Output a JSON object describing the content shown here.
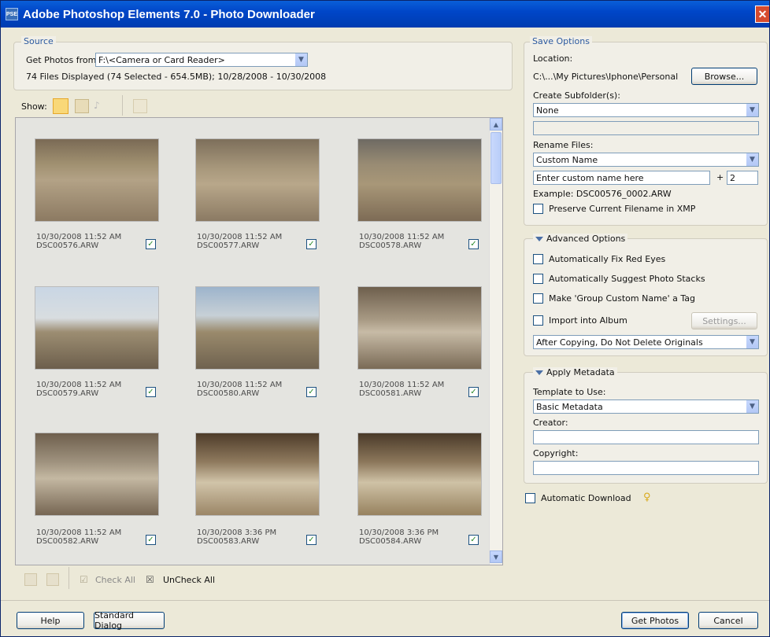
{
  "window": {
    "title": "Adobe Photoshop Elements 7.0 - Photo Downloader",
    "icon_text": "PSE",
    "close_glyph": "✕"
  },
  "source": {
    "legend": "Source",
    "get_from_label": "Get Photos from:",
    "get_from_value": "F:\\<Camera or Card Reader>",
    "summary": "74 Files Displayed (74 Selected - 654.5MB); 10/28/2008 - 10/30/2008"
  },
  "show": {
    "label": "Show:"
  },
  "photos": [
    {
      "date": "10/30/2008 11:52 AM",
      "name": "DSC00576.ARW",
      "checked": true
    },
    {
      "date": "10/30/2008 11:52 AM",
      "name": "DSC00577.ARW",
      "checked": true
    },
    {
      "date": "10/30/2008 11:52 AM",
      "name": "DSC00578.ARW",
      "checked": true
    },
    {
      "date": "10/30/2008 11:52 AM",
      "name": "DSC00579.ARW",
      "checked": true
    },
    {
      "date": "10/30/2008 11:52 AM",
      "name": "DSC00580.ARW",
      "checked": true
    },
    {
      "date": "10/30/2008 11:52 AM",
      "name": "DSC00581.ARW",
      "checked": true
    },
    {
      "date": "10/30/2008 11:52 AM",
      "name": "DSC00582.ARW",
      "checked": true
    },
    {
      "date": "10/30/2008 3:36 PM",
      "name": "DSC00583.ARW",
      "checked": true
    },
    {
      "date": "10/30/2008 3:36 PM",
      "name": "DSC00584.ARW",
      "checked": true
    }
  ],
  "gallery_toolbar": {
    "check_all": "Check All",
    "uncheck_all": "UnCheck All"
  },
  "save_options": {
    "legend": "Save Options",
    "location_label": "Location:",
    "location_value": "C:\\...\\My Pictures\\Iphone\\Personal",
    "browse": "Browse...",
    "subfolder_label": "Create Subfolder(s):",
    "subfolder_value": "None",
    "rename_label": "Rename Files:",
    "rename_value": "Custom Name",
    "custom_name_placeholder": "Enter custom name here",
    "plus": "+",
    "start_number": "2",
    "example": "Example:  DSC00576_0002.ARW",
    "preserve_label": "Preserve Current Filename in XMP"
  },
  "advanced": {
    "title": "Advanced Options",
    "fix_red_eyes": "Automatically Fix Red Eyes",
    "suggest_stacks": "Automatically Suggest Photo Stacks",
    "group_tag": "Make 'Group Custom Name' a Tag",
    "import_album": "Import into Album",
    "settings": "Settings...",
    "after_copying": "After Copying, Do Not Delete Originals"
  },
  "metadata": {
    "title": "Apply Metadata",
    "template_label": "Template to Use:",
    "template_value": "Basic Metadata",
    "creator_label": "Creator:",
    "copyright_label": "Copyright:"
  },
  "auto_download": {
    "label": "Automatic Download"
  },
  "footer": {
    "help": "Help",
    "standard_dialog": "Standard Dialog",
    "get_photos": "Get Photos",
    "cancel": "Cancel"
  }
}
